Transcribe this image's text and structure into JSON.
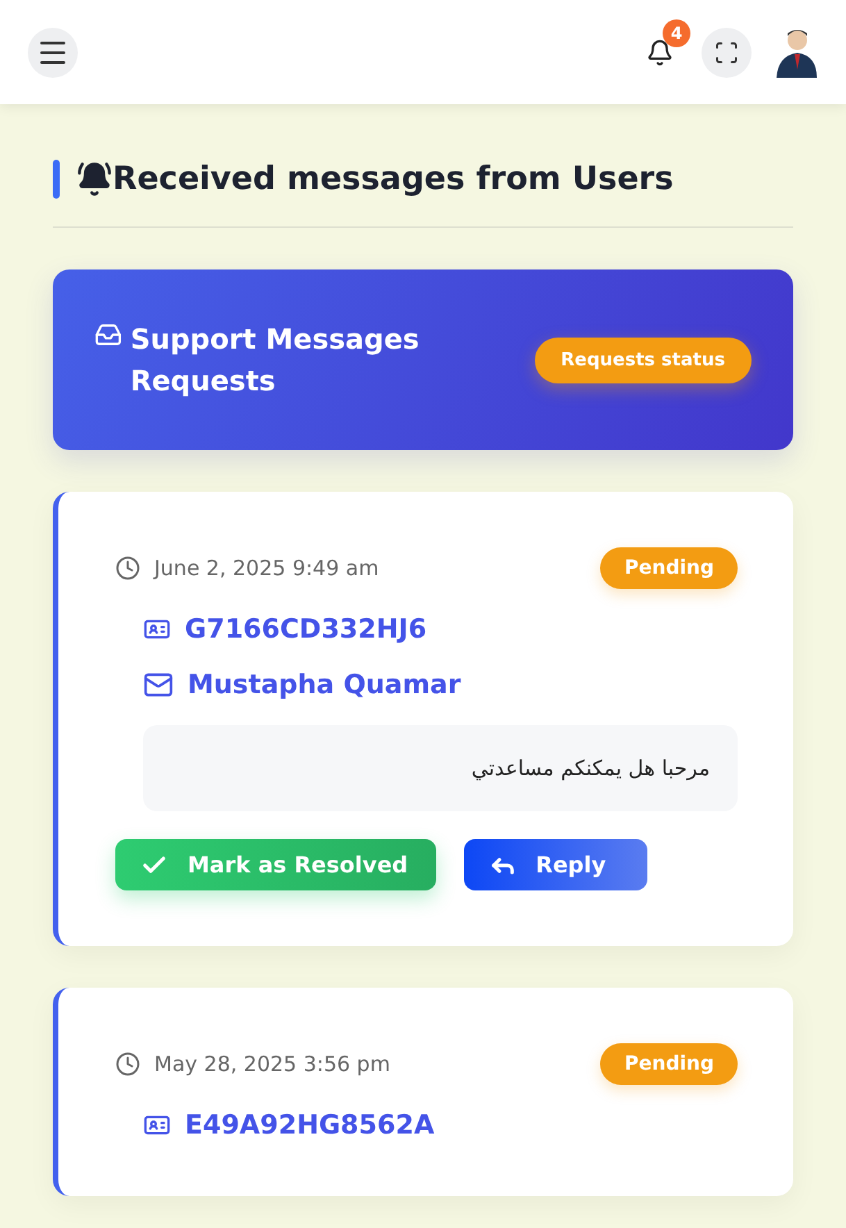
{
  "header": {
    "notification_count": "4"
  },
  "page_title": "Received messages from Users",
  "banner": {
    "title": "Support Messages Requests",
    "button": "Requests status"
  },
  "messages": [
    {
      "date": "June 2, 2025 9:49 am",
      "status": {
        "label": "Pending",
        "kind": "pending"
      },
      "user_id": "G7166CD332HJ6",
      "name": "Mustapha Quamar",
      "text": "مرحبا هل يمكنكم مساعدتي",
      "actions": [
        "Mark as Resolved",
        "Reply"
      ]
    },
    {
      "date": "May 28, 2025 3:56 pm",
      "status": {
        "label": "Pending",
        "kind": "pending"
      },
      "user_id": "E49A92HG8562A"
    }
  ]
}
